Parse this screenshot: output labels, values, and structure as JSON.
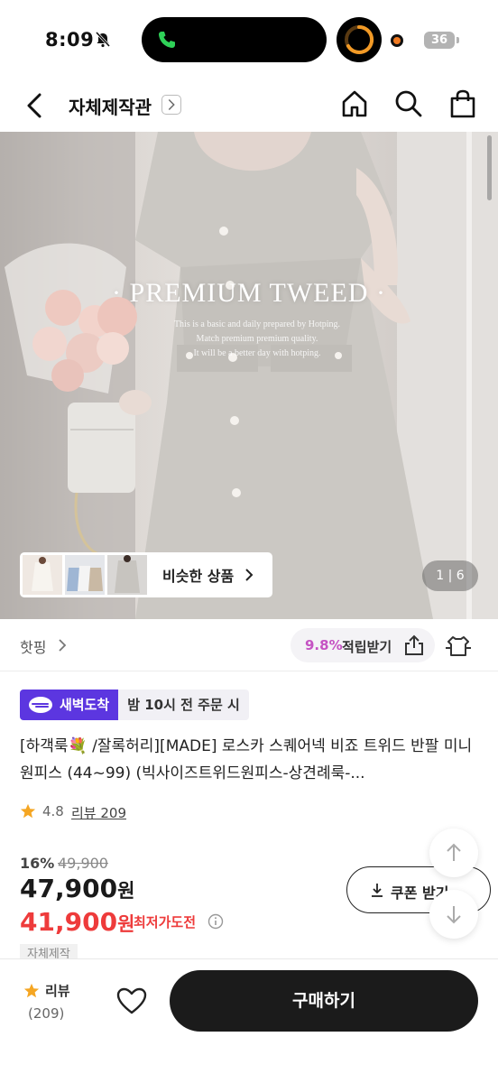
{
  "status_bar": {
    "time": "8:09",
    "battery": "36"
  },
  "nav": {
    "title": "자체제작관"
  },
  "hero": {
    "title": "· PREMIUM TWEED ·",
    "subtitle_lines": [
      "This is a basic and daily prepared by Hotping.",
      "Match premium premium quality.",
      "It will be a better day with hotping."
    ],
    "similar_label": "비슷한 상품",
    "page_counter": "1 | 6"
  },
  "meta": {
    "brand": "핫핑",
    "points_rate": "9.8%",
    "points_label": "적립받기"
  },
  "delivery": {
    "badge": "새벽도착",
    "note": "밤 10시 전 주문 시"
  },
  "product": {
    "title_prefix": "[하객룩",
    "title_emoji": "💐",
    "title_rest": " /잘록허리][MADE] 로스카 스퀘어넥 비죠 트위드 반팔 미니원피스 (44~99) (빅사이즈트위드원피스-상견례룩-...",
    "rating": "4.8",
    "review_link": "리뷰 209"
  },
  "price": {
    "discount_rate": "16%",
    "original": "49,900",
    "current": "47,900",
    "current_unit": "원",
    "best": "41,900",
    "best_unit": "원",
    "best_label": "최저가도전",
    "coupon_label": "쿠폰 받기",
    "tag": "자체제작"
  },
  "bottom_bar": {
    "review_label": "리뷰",
    "review_count": "(209)",
    "buy_label": "구매하기"
  },
  "colors": {
    "delivery_purple": "#5c36e0",
    "points_pink": "#c553c3",
    "sale_red": "#ee3b3b",
    "star_orange": "#f5a623",
    "buy_black": "#1b1b1b"
  }
}
